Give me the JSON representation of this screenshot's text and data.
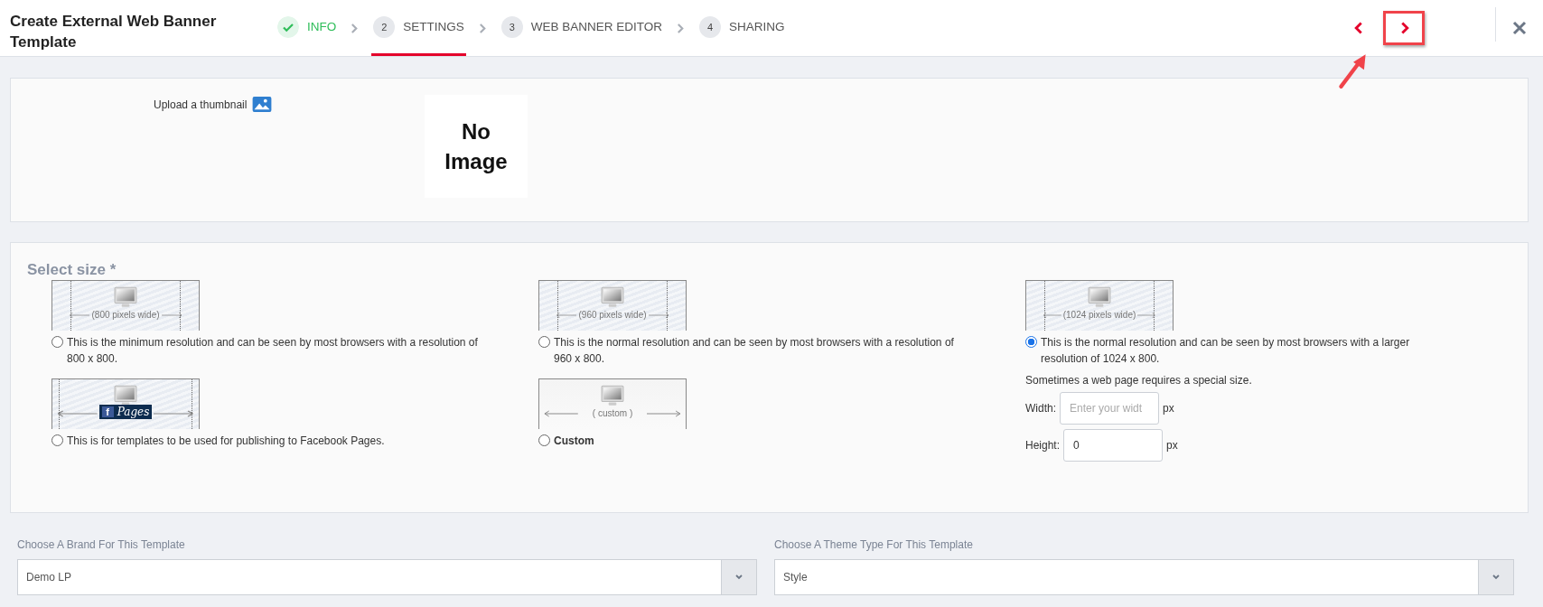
{
  "header": {
    "title": "Create External Web Banner Template",
    "steps": [
      {
        "label": "INFO",
        "kind": "done",
        "selected": false
      },
      {
        "number": "2",
        "label": "SETTINGS",
        "kind": "todo",
        "selected": true
      },
      {
        "number": "3",
        "label": "WEB BANNER EDITOR",
        "kind": "todo",
        "selected": false
      },
      {
        "number": "4",
        "label": "SHARING",
        "kind": "todo",
        "selected": false
      }
    ],
    "nav_buttons": [
      {
        "kind": "previous",
        "highlighted": false
      },
      {
        "kind": "next",
        "highlighted": true
      }
    ]
  },
  "thumbnail": {
    "label": "Upload a thumbnail",
    "image_text": "No Image"
  },
  "size": {
    "title": "Select size *",
    "options": [
      {
        "kind": "width",
        "caption": "(800 pixels wide)",
        "label": "This is the minimum resolution and can be seen by most browsers with a resolution of 800 x 800.",
        "selected": false
      },
      {
        "kind": "width",
        "caption": "(960 pixels wide)",
        "label": "This is the normal resolution and can be seen by most browsers with a resolution of 960 x 800.",
        "selected": false
      },
      {
        "kind": "width",
        "caption": "(1024 pixels wide)",
        "label": "This is the normal resolution and can be seen by most browsers with a larger resolution of 1024 x 800.",
        "selected": true
      },
      {
        "kind": "facebook",
        "caption": "Pages",
        "badge_letter": "f",
        "label": "This is for templates to be used for publishing to Facebook Pages.",
        "selected": false
      },
      {
        "kind": "custom",
        "caption": "( custom )",
        "label": "Custom",
        "selected": false
      }
    ],
    "special": {
      "note": "Sometimes a web page requires a special size.",
      "fields": [
        {
          "label": "Width:",
          "placeholder": "Enter your widt",
          "unit": "px"
        },
        {
          "label": "Height:",
          "value": "0",
          "unit": "px"
        }
      ]
    }
  },
  "selects": [
    {
      "label": "Choose A Brand For This Template",
      "value": "Demo LP"
    },
    {
      "label": "Choose A Theme Type For This Template",
      "value": "Style"
    }
  ]
}
